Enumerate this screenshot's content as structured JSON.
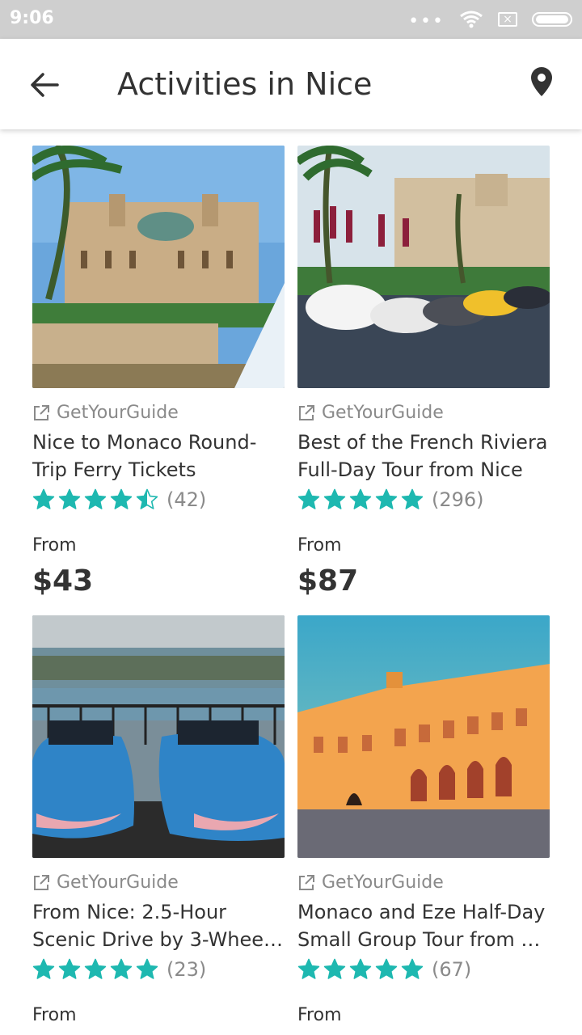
{
  "status_bar": {
    "time": "9:06"
  },
  "app_bar": {
    "title": "Activities in Nice"
  },
  "icons": {
    "back": "arrow-left-icon",
    "location": "map-pin-icon",
    "external": "external-link-icon",
    "star": "star-icon"
  },
  "colors": {
    "accent": "#1EB8B0",
    "text": "#333333",
    "muted": "#8A8A8A",
    "statusbar": "#CFCFCF"
  },
  "activities": [
    {
      "provider": "GetYourGuide",
      "title_line1": "Nice to Monaco Round-",
      "title_line2": "Trip Ferry Tickets",
      "rating": 4.5,
      "reviews": "(42)",
      "from_label": "From",
      "price": "$43",
      "image": "monaco-casino-photo"
    },
    {
      "provider": "GetYourGuide",
      "title_line1": "Best of the French Riviera",
      "title_line2": "Full-Day Tour from Nice",
      "rating": 5,
      "reviews": "(296)",
      "from_label": "From",
      "price": "$87",
      "image": "monte-carlo-cars-photo"
    },
    {
      "provider": "GetYourGuide",
      "title_line1": "From Nice: 2.5-Hour",
      "title_line2": "Scenic Drive by 3-Wheel…",
      "rating": 5,
      "reviews": "(23)",
      "from_label": "From",
      "price": "",
      "image": "nicecar-vehicles-photo"
    },
    {
      "provider": "GetYourGuide",
      "title_line1": "Monaco and Eze Half-Day",
      "title_line2": "Small Group Tour from …",
      "rating": 5,
      "reviews": "(67)",
      "from_label": "From",
      "price": "",
      "image": "monaco-palace-photo"
    }
  ]
}
